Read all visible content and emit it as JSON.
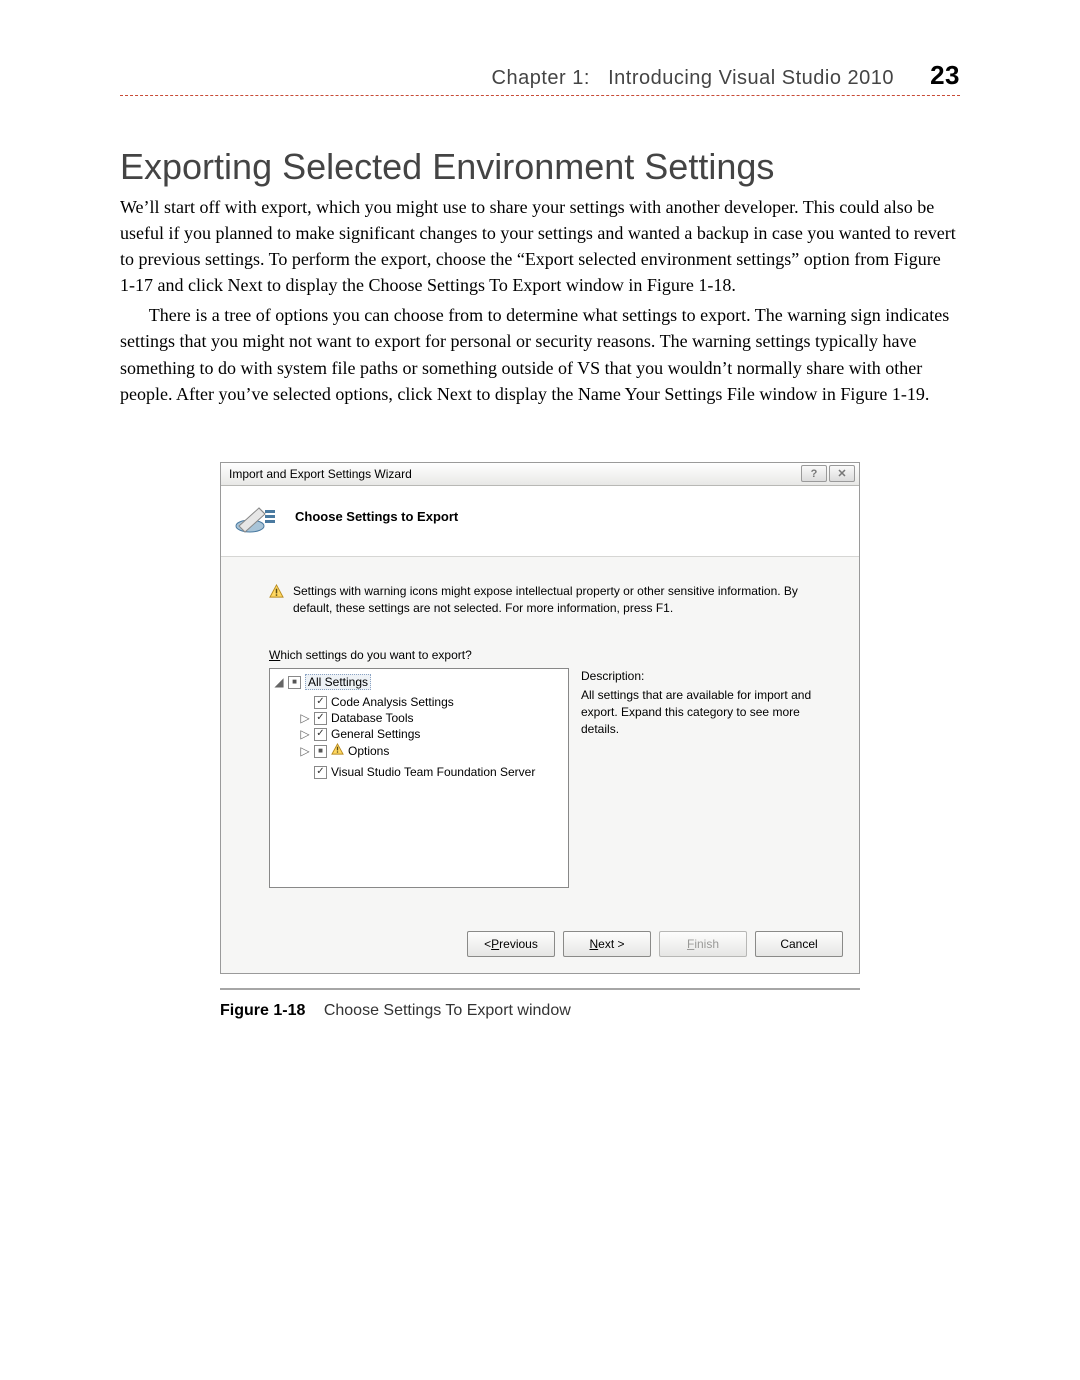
{
  "header": {
    "chapter_label": "Chapter 1:",
    "chapter_title": "Introducing Visual Studio 2010",
    "page_number": "23"
  },
  "section": {
    "title": "Exporting Selected Environment Settings",
    "para1": "We’ll start off with export, which you might use to share your settings with another developer. This could also be useful if you planned to make significant changes to your settings and wanted a backup in case you wanted to revert to previous settings. To perform the export, choose the “Export selected environment settings” option from Figure 1-17 and click Next to display the Choose Settings To Export window in Figure 1-18.",
    "para2": "There is a tree of options you can choose from to determine what settings to export. The warning sign indicates settings that you might not want to export for personal or security reasons. The warning settings typically have something to do with system file paths or something outside of VS that you wouldn’t normally share with other people. After you’ve selected options, click Next to display the Name Your Settings File window in Figure 1-19."
  },
  "dialog": {
    "title": "Import and Export Settings Wizard",
    "step_title": "Choose Settings to Export",
    "warning_text": "Settings with warning icons might expose intellectual property or other sensitive information. By default, these settings are not selected. For more information, press F1.",
    "prompt_mnemonic": "W",
    "prompt_rest": "hich settings do you want to export?",
    "root_label": "All Settings",
    "children": [
      {
        "label": "Code Analysis Settings"
      },
      {
        "label": "Database Tools"
      },
      {
        "label": "General Settings"
      },
      {
        "label": "Options"
      },
      {
        "label": "Visual Studio Team Foundation Server"
      }
    ],
    "description_heading": "Description:",
    "description_text": "All settings that are available for import and export. Expand this category to see more details.",
    "buttons": {
      "previous_u": "P",
      "previous_rest": "revious",
      "next_u": "N",
      "next_rest": "ext >",
      "finish_u": "F",
      "finish_rest": "inish",
      "cancel": "Cancel"
    }
  },
  "caption": {
    "lead": "Figure 1-18",
    "text": "Choose Settings To Export window"
  }
}
